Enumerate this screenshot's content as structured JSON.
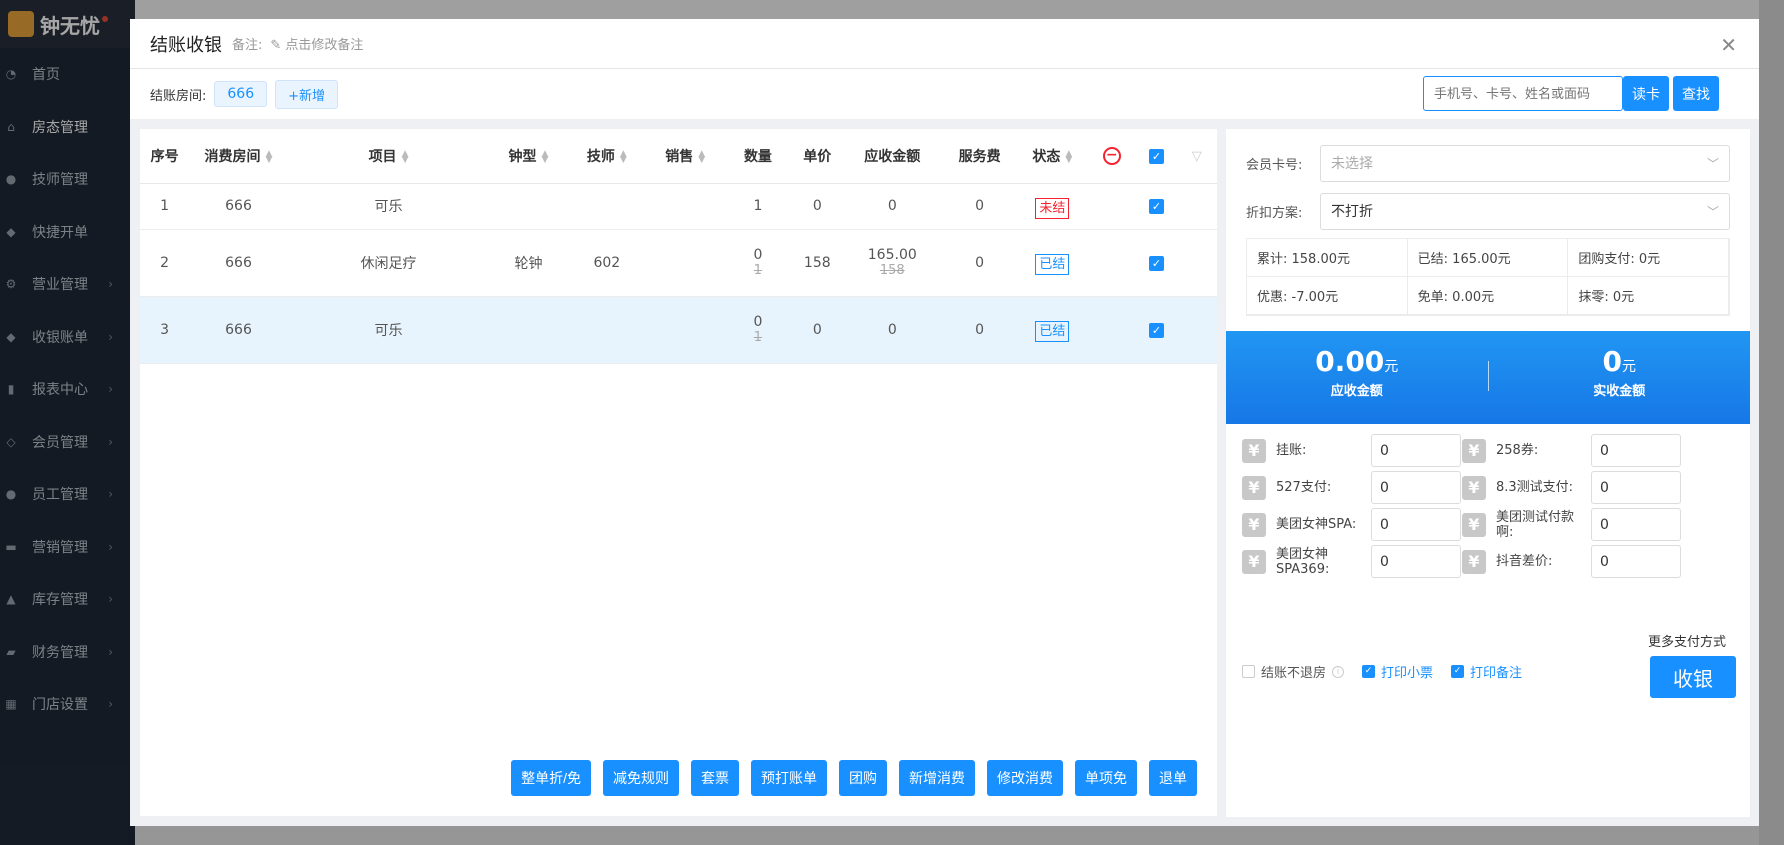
{
  "app": {
    "logo_text": "钟无忧"
  },
  "sidebar": {
    "items": [
      {
        "label": "首页",
        "icon": "dashboard-icon",
        "chev": false
      },
      {
        "label": "房态管理",
        "icon": "home-icon",
        "chev": false,
        "active": true
      },
      {
        "label": "技师管理",
        "icon": "user-icon",
        "chev": false
      },
      {
        "label": "快捷开单",
        "icon": "bag-icon",
        "chev": false
      },
      {
        "label": "营业管理",
        "icon": "gear-icon",
        "chev": true
      },
      {
        "label": "收银账单",
        "icon": "money-bag-icon",
        "chev": true
      },
      {
        "label": "报表中心",
        "icon": "bar-chart-icon",
        "chev": true
      },
      {
        "label": "会员管理",
        "icon": "diamond-icon",
        "chev": true
      },
      {
        "label": "员工管理",
        "icon": "user-icon",
        "chev": true
      },
      {
        "label": "营销管理",
        "icon": "briefcase-icon",
        "chev": true
      },
      {
        "label": "库存管理",
        "icon": "warehouse-icon",
        "chev": true
      },
      {
        "label": "财务管理",
        "icon": "wallet-icon",
        "chev": true
      },
      {
        "label": "门店设置",
        "icon": "grid-icon",
        "chev": true
      }
    ]
  },
  "modal": {
    "title": "结账收银",
    "remark_label": "备注:",
    "remark_edit": "✎ 点击修改备注",
    "room_label": "结账房间:",
    "room_chip": "666",
    "add_label": "+新增",
    "search_placeholder": "手机号、卡号、姓名或面码",
    "read_card": "读卡",
    "find": "查找"
  },
  "table": {
    "headers": [
      "序号",
      "消费房间",
      "项目",
      "钟型",
      "技师",
      "销售",
      "数量",
      "单价",
      "应收金额",
      "服务费",
      "状态"
    ],
    "rows": [
      {
        "no": "1",
        "room": "666",
        "item": "可乐",
        "type": "",
        "tech": "",
        "sales": "",
        "qty": "1",
        "qty_old": "",
        "price": "0",
        "amount": "0",
        "amount_old": "",
        "fee": "0",
        "status": "未结",
        "status_color": "red"
      },
      {
        "no": "2",
        "room": "666",
        "item": "休闲足疗",
        "type": "轮钟",
        "tech": "602",
        "sales": "",
        "qty": "0",
        "qty_old": "1",
        "price": "158",
        "amount": "165.00",
        "amount_old": "158",
        "fee": "0",
        "status": "已结",
        "status_color": "blue"
      },
      {
        "no": "3",
        "room": "666",
        "item": "可乐",
        "type": "",
        "tech": "",
        "sales": "",
        "qty": "0",
        "qty_old": "1",
        "price": "0",
        "amount": "0",
        "amount_old": "",
        "fee": "0",
        "status": "已结",
        "status_color": "blue"
      }
    ]
  },
  "actions": [
    "整单折/免",
    "减免规则",
    "套票",
    "预打账单",
    "团购",
    "新增消费",
    "修改消费",
    "单项免",
    "退单"
  ],
  "member": {
    "card_label": "会员卡号:",
    "card_placeholder": "未选择",
    "discount_label": "折扣方案:",
    "discount_value": "不打折"
  },
  "summary": [
    "累计: 158.00元",
    "已结: 165.00元",
    "团购支付: 0元",
    "优惠: -7.00元",
    "免单: 0.00元",
    "抹零: 0元"
  ],
  "totals": {
    "receivable": "0.00",
    "receivable_unit": "元",
    "receivable_label": "应收金额",
    "received": "0",
    "received_unit": "元",
    "received_label": "实收金额"
  },
  "payments": [
    {
      "label": "挂账:",
      "value": "0"
    },
    {
      "label": "258券:",
      "value": "0"
    },
    {
      "label": "527支付:",
      "value": "0"
    },
    {
      "label": "8.3测试支付:",
      "value": "0"
    },
    {
      "label": "美团女神SPA:",
      "value": "0"
    },
    {
      "label": "美团测试付款啊:",
      "value": "0"
    },
    {
      "label": "美团女神SPA369:",
      "value": "0"
    },
    {
      "label": "抖音差价:",
      "value": "0"
    }
  ],
  "more_pay": "更多支付方式",
  "options": {
    "no_checkout": "结账不退房",
    "print_ticket": "打印小票",
    "print_remark": "打印备注"
  },
  "checkout": "收银",
  "colors": {
    "accent": "#1890ff",
    "sidebar": "#1f2937",
    "danger": "#f5222d"
  }
}
